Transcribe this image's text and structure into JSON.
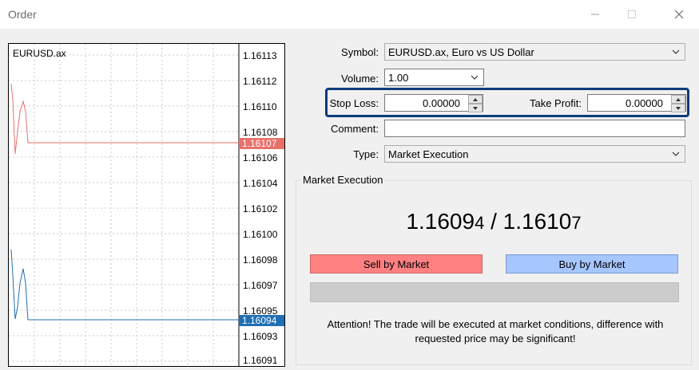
{
  "window": {
    "title": "Order"
  },
  "chart": {
    "symbol": "EURUSD.ax",
    "ticks": [
      "1.16113",
      "1.16112",
      "1.16110",
      "1.16108",
      "1.16106",
      "1.16104",
      "1.16102",
      "1.16100",
      "1.16098",
      "1.16097",
      "1.16095",
      "1.16093",
      "1.16091"
    ],
    "ask_price": "1.16107",
    "bid_price": "1.16094",
    "ask_color": "#e8716b",
    "bid_color": "#1f6fb5"
  },
  "form": {
    "symbol_label": "Symbol:",
    "symbol_value": "EURUSD.ax, Euro vs US Dollar",
    "volume_label": "Volume:",
    "volume_value": "1.00",
    "stoploss_label": "Stop Loss:",
    "stoploss_value": "0.00000",
    "takeprofit_label": "Take Profit:",
    "takeprofit_value": "0.00000",
    "comment_label": "Comment:",
    "comment_value": "",
    "type_label": "Type:",
    "type_value": "Market Execution"
  },
  "execution": {
    "group_title": "Market Execution",
    "bid_main": "1.1609",
    "bid_small": "4",
    "separator": " / ",
    "ask_main": "1.1610",
    "ask_small": "7",
    "sell_label": "Sell by Market",
    "buy_label": "Buy by Market",
    "sell_color": "#ff8080",
    "buy_color": "#a6c6ff",
    "attention_line1": "Attention! The trade will be executed at market conditions, difference with",
    "attention_line2": "requested price may be significant!"
  }
}
